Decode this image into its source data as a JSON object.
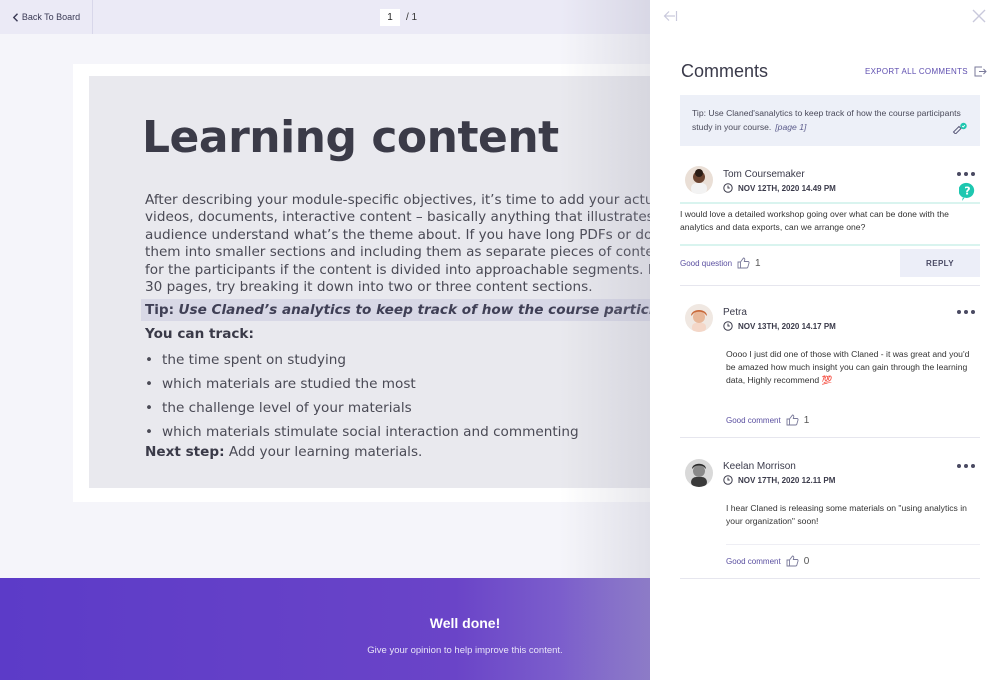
{
  "viewer": {
    "back_label": "Back To Board",
    "page_current": "1",
    "page_total": "/ 1"
  },
  "document": {
    "title": "Learning content",
    "paragraph": [
      "After describing your module-specific objectives, it’s time to add your actual learning",
      "videos, documents, interactive content – basically anything that illustrates your ther",
      "audience understand what’s the theme about. If you have long PDFs or documents,",
      "them into smaller sections and including them as separate pieces of content. We ha",
      "for the participants if the content is divided into approachable segments. For examp",
      "30 pages, try breaking it down into two or three content sections."
    ],
    "tip_prefix": "Tip:",
    "tip_text": "Use Claned’s analytics to keep track of how the course participants study in yo",
    "track_heading": "You can track:",
    "track_items": [
      "the time spent on studying",
      "which materials are studied the most",
      "the challenge level of your materials",
      "which materials stimulate social interaction and commenting"
    ],
    "next_step_label": "Next step:",
    "next_step_text": "Add your learning materials."
  },
  "footer": {
    "title": "Well done!",
    "subtitle": "Give your opinion to help improve this content."
  },
  "panel": {
    "title": "Comments",
    "export_label": "EXPORT ALL COMMENTS",
    "tip_text": "Tip: Use Claned'sanalytics to keep track of how the course participants study in your course.",
    "tip_page_ref": "[page 1]"
  },
  "comments": [
    {
      "name": "Tom Coursemaker",
      "date": "NOV 12TH, 2020 14.49 PM",
      "text": "I would love a detailed workshop going over what can be done with the analytics and data exports, can we arrange one?",
      "reaction_label": "Good question",
      "reaction_count": "1",
      "reply_label": "REPLY"
    },
    {
      "name": "Petra",
      "date": "NOV 13TH, 2020 14.17 PM",
      "text": "Oooo I just did one of those with Claned - it was great and you'd be amazed how much insight you can gain through the learning data, Highly recommend 💯",
      "reaction_label": "Good comment",
      "reaction_count": "1"
    },
    {
      "name": "Keelan Morrison",
      "date": "NOV 17TH, 2020 12.11 PM",
      "text": "I hear Claned is releasing some materials on \"using analytics in your organization\"  soon!",
      "reaction_label": "Good comment",
      "reaction_count": "0"
    }
  ],
  "colors": {
    "accent": "#5f4fb0",
    "footer": "#5c3bc8",
    "help": "#1ec7b0"
  }
}
